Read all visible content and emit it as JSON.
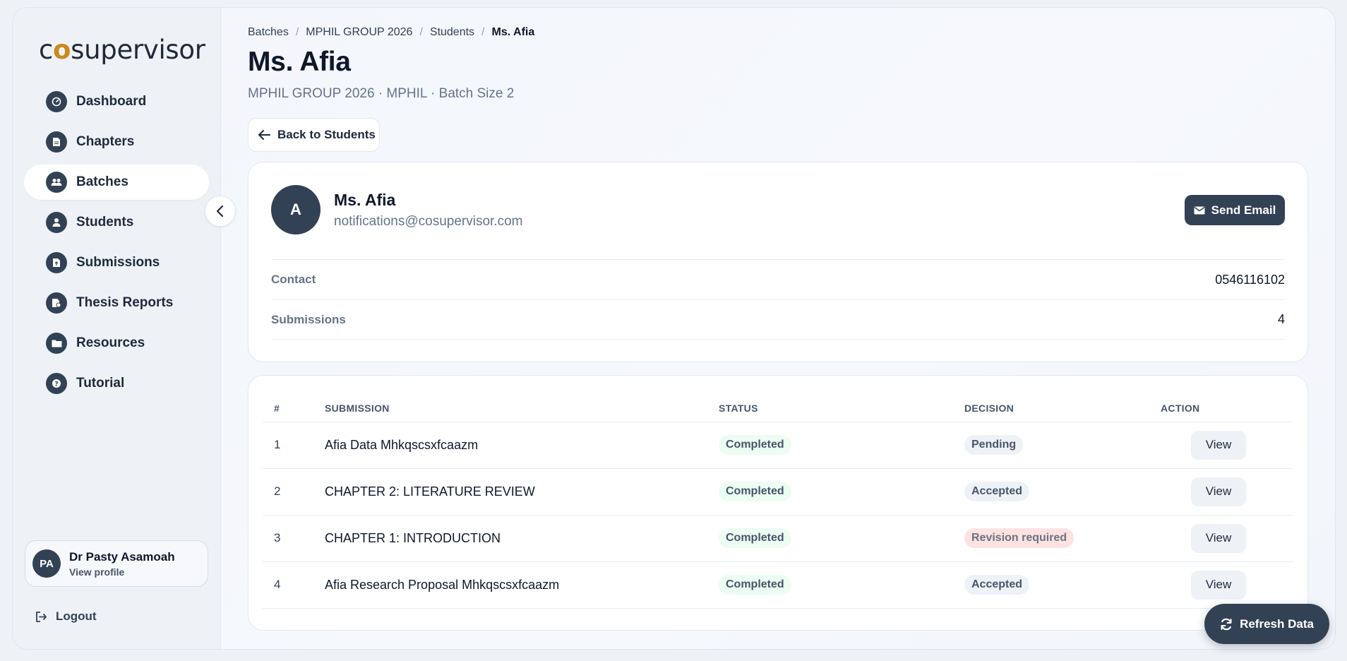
{
  "brand": {
    "logo_pre": "c",
    "logo_o": "o",
    "logo_post": "supervisor"
  },
  "sidebar": {
    "items": [
      {
        "label": "Dashboard",
        "icon": "gauge-icon"
      },
      {
        "label": "Chapters",
        "icon": "document-icon"
      },
      {
        "label": "Batches",
        "icon": "users-icon",
        "active": true
      },
      {
        "label": "Students",
        "icon": "student-icon"
      },
      {
        "label": "Submissions",
        "icon": "upload-file-icon"
      },
      {
        "label": "Thesis Reports",
        "icon": "report-icon"
      },
      {
        "label": "Resources",
        "icon": "folder-icon"
      },
      {
        "label": "Tutorial",
        "icon": "help-icon"
      }
    ],
    "profile": {
      "initials": "PA",
      "name": "Dr Pasty Asamoah",
      "link": "View profile"
    },
    "logout": "Logout"
  },
  "breadcrumb": [
    "Batches",
    "MPHIL GROUP 2026",
    "Students",
    "Ms. Afia"
  ],
  "page": {
    "title": "Ms. Afia",
    "subtitle": "MPHIL GROUP 2026 · MPHIL · Batch Size 2",
    "back_label": "Back to Students"
  },
  "student": {
    "initial": "A",
    "name": "Ms. Afia",
    "email": "notifications@cosupervisor.com",
    "send_email_label": "Send Email",
    "contact_label": "Contact",
    "contact_value": "0546116102",
    "submissions_label": "Submissions",
    "submissions_value": "4"
  },
  "table": {
    "headers": [
      "#",
      "SUBMISSION",
      "STATUS",
      "DECISION",
      "ACTION"
    ],
    "rows": [
      {
        "num": "1",
        "title": "Afia Data Mhkqscsxfcaazm",
        "status": "Completed",
        "decision": "Pending",
        "decision_style": "neutral",
        "action": "View"
      },
      {
        "num": "2",
        "title": "CHAPTER 2: LITERATURE REVIEW",
        "status": "Completed",
        "decision": "Accepted",
        "decision_style": "neutral",
        "action": "View"
      },
      {
        "num": "3",
        "title": "CHAPTER 1: INTRODUCTION",
        "status": "Completed",
        "decision": "Revision required",
        "decision_style": "danger",
        "action": "View"
      },
      {
        "num": "4",
        "title": "Afia Research Proposal Mhkqscsxfcaazm",
        "status": "Completed",
        "decision": "Accepted",
        "decision_style": "neutral",
        "action": "View"
      }
    ]
  },
  "refresh_label": "Refresh Data"
}
